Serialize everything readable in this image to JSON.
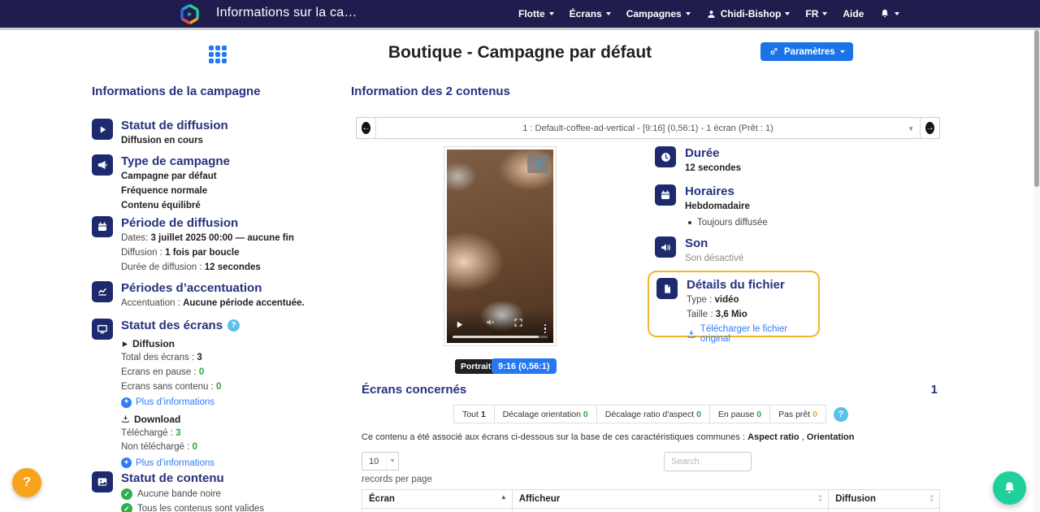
{
  "navbar": {
    "title": "Informations sur la ca…",
    "menu": [
      {
        "label": "Flotte"
      },
      {
        "label": "Écrans"
      },
      {
        "label": "Campagnes"
      },
      {
        "label": "Chidi-Bishop"
      },
      {
        "label": "FR"
      },
      {
        "label": "Aide"
      }
    ]
  },
  "header": {
    "title": "Boutique - Campagne par défaut",
    "settings_label": "Paramètres"
  },
  "sidebar": {
    "title": "Informations de la campagne",
    "broadcast_status": {
      "title": "Statut de diffusion",
      "status": "Diffusion en cours"
    },
    "campaign_type": {
      "title": "Type de campagne",
      "line1": "Campagne par défaut",
      "line2": "Fréquence normale",
      "line3": "Contenu équilibré"
    },
    "broadcast_period": {
      "title": "Période de diffusion",
      "dates_label": "Dates: ",
      "dates_value": "3 juillet 2025 00:00 — aucune fin",
      "diffusion_label": "Diffusion : ",
      "diffusion_value": "1 fois par boucle",
      "duration_label": "Durée de diffusion : ",
      "duration_value": "12 secondes"
    },
    "accent_periods": {
      "title": "Périodes d’accentuation",
      "label": "Accentuation : ",
      "value": "Aucune période accentuée."
    },
    "screens_status": {
      "title": "Statut des écrans",
      "help": "?",
      "diffusion_header": "Diffusion",
      "total_label": "Total des écrans : ",
      "total_value": "3",
      "paused_label": "Ecrans en pause : ",
      "paused_value": "0",
      "no_content_label": "Ecrans sans contenu : ",
      "no_content_value": "0",
      "more_info": "Plus d’informations",
      "download_header": "Download",
      "downloaded_label": "Téléchargé : ",
      "downloaded_value": "3",
      "not_downloaded_label": "Non téléchargé : ",
      "not_downloaded_value": "0",
      "more_info2": "Plus d’informations"
    },
    "content_status": {
      "title": "Statut de contenu",
      "check1": "Aucune bande noire",
      "check2": "Tous les contenus sont valides"
    }
  },
  "content": {
    "title": "Information des 2 contenus",
    "carousel_value": "1 : Default-coffee-ad-vertical - [9:16] (0,56:1) - 1 écran (Prêt : 1)",
    "badge_orientation": "Portrait",
    "badge_ratio": "9:16 (0,56:1)",
    "duration": {
      "title": "Durée",
      "value": "12 secondes"
    },
    "schedule": {
      "title": "Horaires",
      "value": "Hebdomadaire",
      "bullet": "Toujours diffusée"
    },
    "sound": {
      "title": "Son",
      "value": "Son désactivé"
    },
    "file_details": {
      "title": "Détails du fichier",
      "type_label": "Type : ",
      "type_value": "vidéo",
      "size_label": "Taille : ",
      "size_value": "3,6 Mio",
      "download_link": "Télécharger le fichier original"
    }
  },
  "screens": {
    "title": "Écrans concernés",
    "count": "1",
    "filters": [
      {
        "label": "Tout ",
        "value": "1"
      },
      {
        "label": "Décalage orientation ",
        "value": "0"
      },
      {
        "label": "Décalage ratio d'aspect ",
        "value": "0"
      },
      {
        "label": "En pause ",
        "value": "0"
      },
      {
        "label": "Pas prêt ",
        "value": "0"
      }
    ],
    "filters_help": "?",
    "assoc_text": "Ce contenu a été associé aux écrans ci-dessous sur la base de ces caractéristiques communes : ",
    "assoc_feature1": "Aspect ratio",
    "assoc_sep": " , ",
    "assoc_feature2": "Orientation",
    "per_page_value": "10",
    "per_page_label": "records per page",
    "search_placeholder": "Search",
    "table_headers": [
      "Écran",
      "Afficheur",
      "Diffusion"
    ]
  },
  "fabs": {
    "help_label": "?"
  }
}
